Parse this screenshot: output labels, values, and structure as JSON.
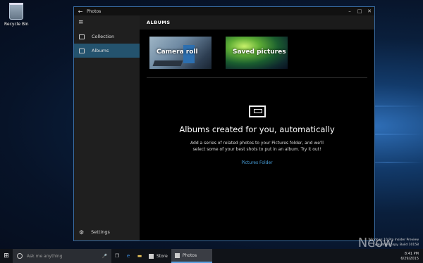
{
  "desktop": {
    "recycle_bin_label": "Recycle Bin"
  },
  "window": {
    "title": "Photos",
    "controls": {
      "minimize": "–",
      "maximize": "□",
      "close": "✕"
    }
  },
  "nav": {
    "items": [
      {
        "label": "Collection"
      },
      {
        "label": "Albums"
      }
    ],
    "settings_label": "Settings"
  },
  "main": {
    "header": "ALBUMS",
    "tiles": [
      {
        "label": "Camera roll"
      },
      {
        "label": "Saved pictures"
      }
    ],
    "empty_state": {
      "heading": "Albums created for you, automatically",
      "body": "Add a series of related photos to your Pictures folder, and we'll select some of your best shots to put in an album. Try it out!",
      "link": "Pictures Folder"
    }
  },
  "taskbar": {
    "search_placeholder": "Ask me anything",
    "apps": [
      {
        "label": "Store"
      },
      {
        "label": "Photos"
      }
    ]
  },
  "watermark": {
    "line1": "Windows 10 Pro Insider Preview",
    "line2": "Evaluation copy. Build 10158"
  },
  "clock": {
    "time": "8:41 PM",
    "date": "6/29/2015"
  },
  "brand": "Neow"
}
